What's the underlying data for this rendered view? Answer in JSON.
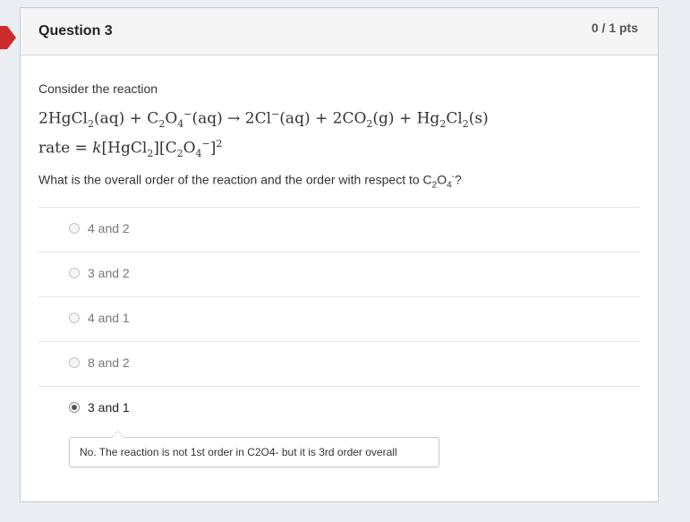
{
  "question": {
    "title": "Question 3",
    "points": "0 / 1 pts",
    "intro": "Consider the reaction",
    "prompt_prefix": "What is the overall order of the reaction and the order with respect to C",
    "prompt_sub1": "2",
    "prompt_o": "O",
    "prompt_sub2": "4",
    "prompt_sup": "-",
    "prompt_suffix": "?"
  },
  "equation": {
    "reaction": {
      "t1": "2HgCl",
      "t1s": "2",
      "t2": "(aq)  + C",
      "t2s": "2",
      "t3": "O",
      "t3s": "4",
      "t3p": "−",
      "t4": "(aq)  →  2Cl",
      "t4p": "−",
      "t5": "(aq)  +  2CO",
      "t5s": "2",
      "t6": "(g) + Hg",
      "t6s": "2",
      "t7": "Cl",
      "t7s": "2",
      "t8": "(s)"
    },
    "rate": {
      "r1": "rate = ",
      "r2": "k",
      "r3": "[HgCl",
      "r3s": "2",
      "r4": "][C",
      "r4s": "2",
      "r5": "O",
      "r5s": "4",
      "r5p": "−",
      "r6": "]",
      "r6p": "2"
    }
  },
  "answers": [
    {
      "label": "4 and 2",
      "selected": false
    },
    {
      "label": "3 and 2",
      "selected": false
    },
    {
      "label": "4 and 1",
      "selected": false
    },
    {
      "label": "8 and 2",
      "selected": false
    },
    {
      "label": "3 and 1",
      "selected": true
    }
  ],
  "feedback": "No. The reaction is not 1st order in C2O4- but it is 3rd order overall",
  "colors": {
    "flag": "#cc2b2b",
    "header_bg": "#f5f5f5",
    "page_bg": "#eaeef2"
  }
}
